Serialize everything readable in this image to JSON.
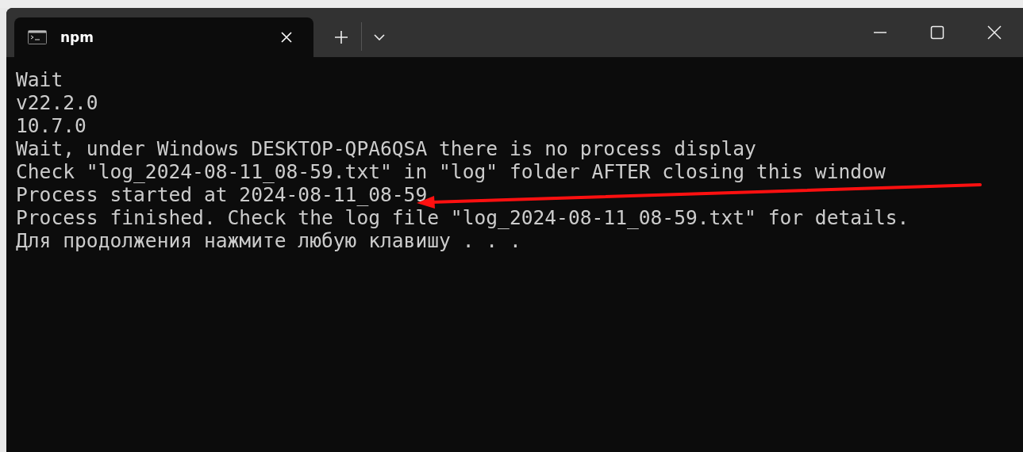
{
  "tabs": [
    {
      "label": "npm",
      "selected": true
    }
  ],
  "terminal": {
    "lines": [
      "Wait",
      "v22.2.0",
      "10.7.0",
      "Wait, under Windows DESKTOP-QPA6QSA there is no process display",
      "Check \"log_2024-08-11_08-59.txt\" in \"log\" folder AFTER closing this window",
      "Process started at 2024-08-11_08-59",
      "Process finished. Check the log file \"log_2024-08-11_08-59.txt\" for details.",
      "Для продолжения нажмите любую клавишу . . ."
    ]
  }
}
